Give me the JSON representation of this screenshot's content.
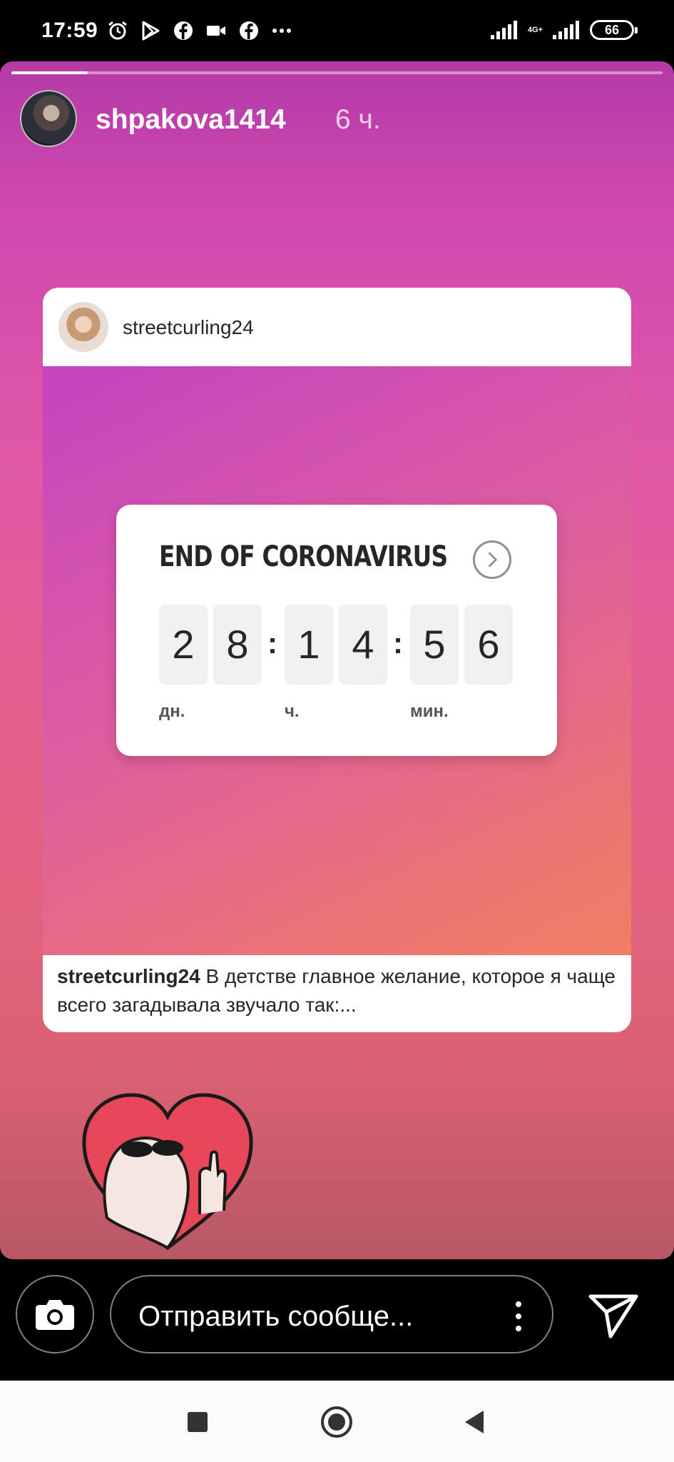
{
  "status_bar": {
    "time": "17:59",
    "network": "4G+",
    "battery": "66"
  },
  "story": {
    "progress": 0.117,
    "username": "shpakova1414",
    "time_ago": "6 ч."
  },
  "post": {
    "username": "streetcurling24",
    "countdown": {
      "title": "END OF CORONAVIRUS",
      "digits": [
        "2",
        "8",
        "1",
        "4",
        "5",
        "6"
      ],
      "separator": ":",
      "units": [
        "дн.",
        "ч.",
        "мин."
      ]
    },
    "caption_user": "streetcurling24",
    "caption_text": " В детстве главное желание, которое я чаще всего загадывала звучало так:..."
  },
  "reply_bar": {
    "placeholder": "Отправить сообще..."
  },
  "colors": {
    "story_gradient_top": "#b43aa6",
    "story_gradient_bottom": "#b85865",
    "card_gradient_start": "#c541c0",
    "card_gradient_end": "#ef7f63"
  }
}
